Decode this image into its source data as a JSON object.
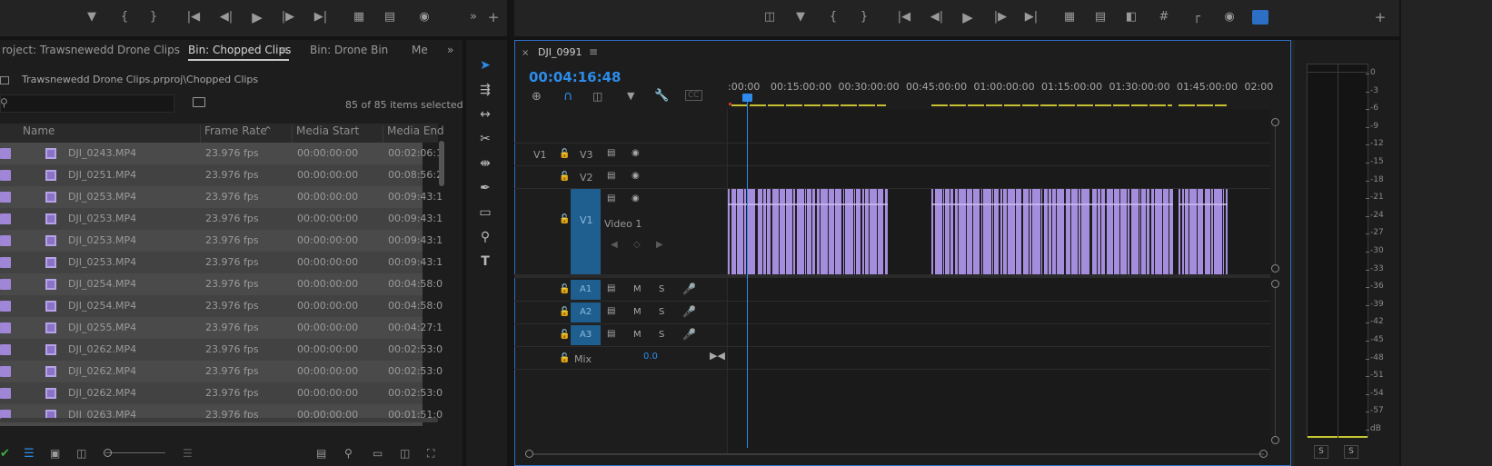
{
  "project_panel": {
    "tabs": [
      {
        "label": "roject: Trawsnewedd Drone Clips"
      },
      {
        "label": "Bin: Chopped Clips"
      },
      {
        "label": "Bin: Drone Bin"
      },
      {
        "label": "Me"
      }
    ],
    "path": "Trawsnewedd Drone Clips.prproj\\Chopped Clips",
    "items_count": "85 of 85 items selected",
    "columns": [
      "Name",
      "Frame Rate",
      "Media Start",
      "Media End"
    ],
    "rows": [
      {
        "name": "DJI_0243.MP4",
        "fps": "23.976 fps",
        "start": "00:00:00:00",
        "end": "00:02:06:1"
      },
      {
        "name": "DJI_0251.MP4",
        "fps": "23.976 fps",
        "start": "00:00:00:00",
        "end": "00:08:56:2"
      },
      {
        "name": "DJI_0253.MP4",
        "fps": "23.976 fps",
        "start": "00:00:00:00",
        "end": "00:09:43:1"
      },
      {
        "name": "DJI_0253.MP4",
        "fps": "23.976 fps",
        "start": "00:00:00:00",
        "end": "00:09:43:1"
      },
      {
        "name": "DJI_0253.MP4",
        "fps": "23.976 fps",
        "start": "00:00:00:00",
        "end": "00:09:43:1"
      },
      {
        "name": "DJI_0253.MP4",
        "fps": "23.976 fps",
        "start": "00:00:00:00",
        "end": "00:09:43:1"
      },
      {
        "name": "DJI_0254.MP4",
        "fps": "23.976 fps",
        "start": "00:00:00:00",
        "end": "00:04:58:0"
      },
      {
        "name": "DJI_0254.MP4",
        "fps": "23.976 fps",
        "start": "00:00:00:00",
        "end": "00:04:58:0"
      },
      {
        "name": "DJI_0255.MP4",
        "fps": "23.976 fps",
        "start": "00:00:00:00",
        "end": "00:04:27:1"
      },
      {
        "name": "DJI_0262.MP4",
        "fps": "23.976 fps",
        "start": "00:00:00:00",
        "end": "00:02:53:0"
      },
      {
        "name": "DJI_0262.MP4",
        "fps": "23.976 fps",
        "start": "00:00:00:00",
        "end": "00:02:53:0"
      },
      {
        "name": "DJI_0262.MP4",
        "fps": "23.976 fps",
        "start": "00:00:00:00",
        "end": "00:02:53:0"
      },
      {
        "name": "DJI_0263.MP4",
        "fps": "23.976 fps",
        "start": "00:00:00:00",
        "end": "00:01:51:0"
      }
    ]
  },
  "timeline": {
    "tab_label": "DJI_0991",
    "timecode": "00:04:16:48",
    "ruler": [
      ":00:00",
      "00:15:00:00",
      "00:30:00:00",
      "00:45:00:00",
      "01:00:00:00",
      "01:15:00:00",
      "01:30:00:00",
      "01:45:00:00",
      "02:00"
    ],
    "video_tracks": [
      {
        "src": "V1",
        "label": "V3"
      },
      {
        "label": "V2"
      },
      {
        "label": "V1",
        "name": "Video 1"
      }
    ],
    "audio_tracks": [
      "A1",
      "A2",
      "A3"
    ],
    "mix_label": "Mix",
    "mix_value": "0.0"
  },
  "meter": {
    "db_labels": [
      "0",
      "-3",
      "-6",
      "-9",
      "-12",
      "-15",
      "-18",
      "-21",
      "-24",
      "-27",
      "-30",
      "-33",
      "-36",
      "-39",
      "-42",
      "-45",
      "-48",
      "-51",
      "-54",
      "-57",
      "dB"
    ],
    "solo_labels": [
      "S",
      "S"
    ]
  },
  "colors": {
    "accent_blue": "#2d8ceb",
    "clip_purple": "#a58ddd",
    "track_blue": "#1f5f8f"
  }
}
